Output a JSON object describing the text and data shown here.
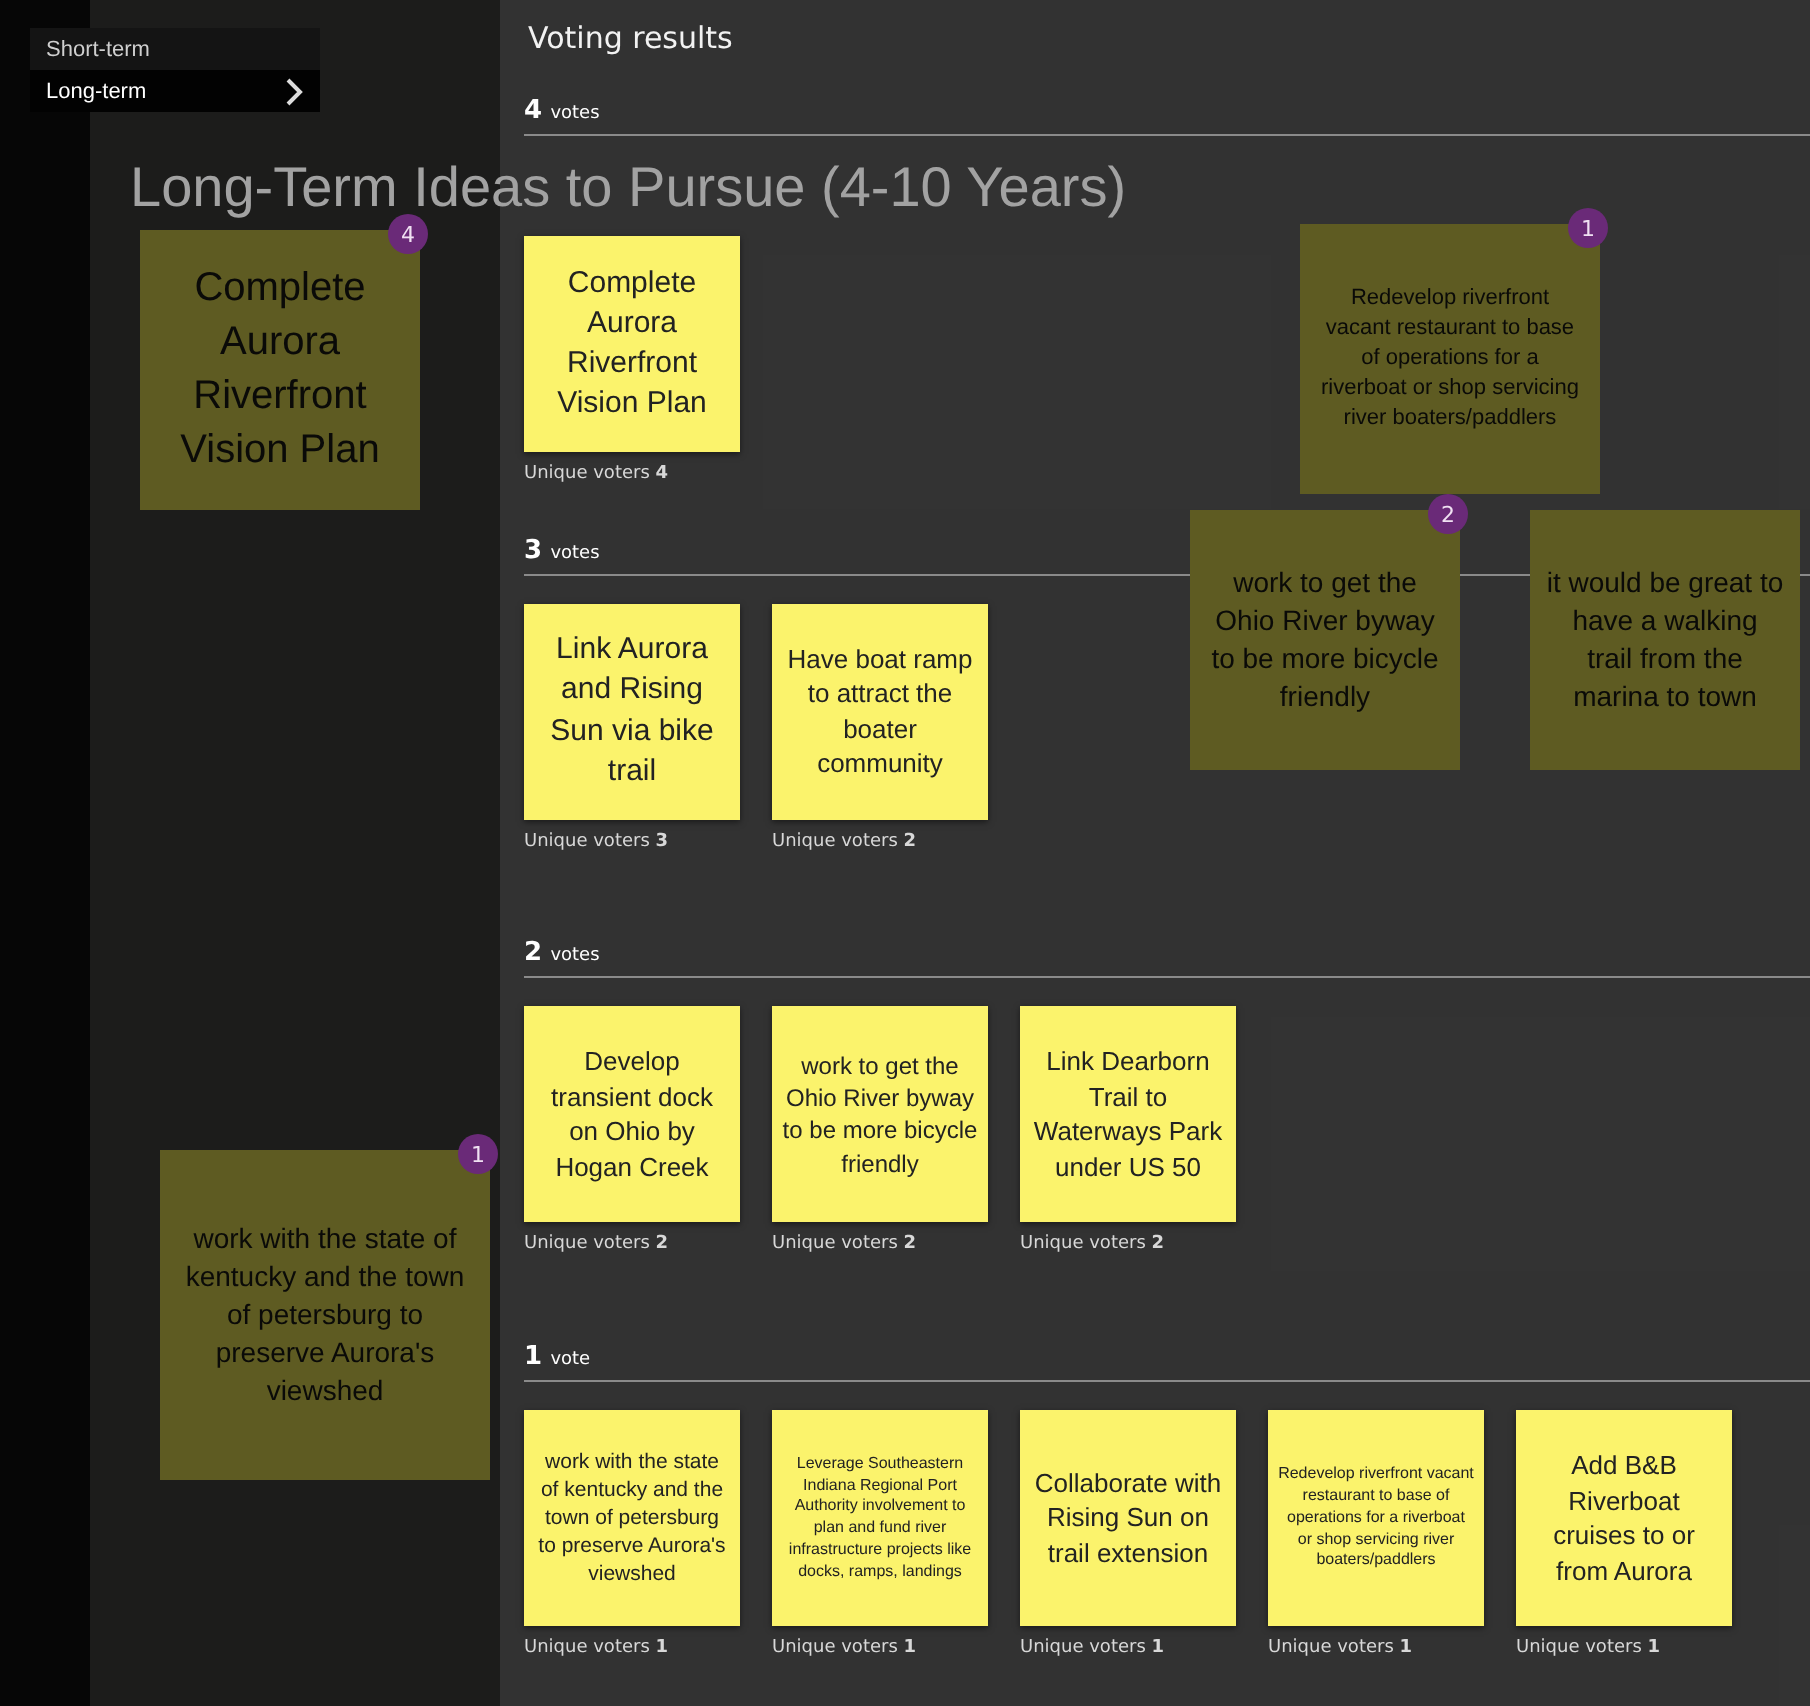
{
  "menu": {
    "items": [
      {
        "label": "Short-term",
        "selected": false
      },
      {
        "label": "Long-term",
        "selected": true
      }
    ]
  },
  "board": {
    "title": "Long-Term Ideas to Pursue (4-10 Years)",
    "notes": [
      {
        "text": "Complete Aurora Riverfront Vision Plan",
        "badge": "4"
      },
      {
        "text": "work with the state of kentucky and the town of petersburg to preserve Aurora's viewshed",
        "badge": "1"
      },
      {
        "text": "Redevelop riverfront vacant restaurant to base of operations for a riverboat or shop servicing river boaters/paddlers",
        "badge": "1"
      },
      {
        "text": "work to get the Ohio River byway to be more bicycle friendly",
        "badge": "2"
      },
      {
        "text": "it would be great to have a walking trail from the marina to town"
      }
    ]
  },
  "voting": {
    "title": "Voting results",
    "groups": [
      {
        "count": "4",
        "unit": "votes",
        "ideas": [
          {
            "text": "Complete Aurora Riverfront Vision Plan",
            "voters_label": "Unique voters",
            "voters": "4"
          }
        ]
      },
      {
        "count": "3",
        "unit": "votes",
        "ideas": [
          {
            "text": "Link Aurora and Rising Sun via bike trail",
            "voters_label": "Unique voters",
            "voters": "3"
          },
          {
            "text": "Have boat ramp to attract the boater community",
            "voters_label": "Unique voters",
            "voters": "2"
          }
        ]
      },
      {
        "count": "2",
        "unit": "votes",
        "ideas": [
          {
            "text": "Develop transient dock on Ohio by Hogan Creek",
            "voters_label": "Unique voters",
            "voters": "2"
          },
          {
            "text": "work to get the Ohio River byway to be more bicycle friendly",
            "voters_label": "Unique voters",
            "voters": "2"
          },
          {
            "text": "Link Dearborn Trail to Waterways Park under US 50",
            "voters_label": "Unique voters",
            "voters": "2"
          }
        ]
      },
      {
        "count": "1",
        "unit": "vote",
        "ideas": [
          {
            "text": "work with the state of kentucky and the town of petersburg to preserve Aurora's viewshed",
            "voters_label": "Unique voters",
            "voters": "1"
          },
          {
            "text": "Leverage Southeastern Indiana Regional Port Authority involvement to plan and fund river infrastructure projects like docks, ramps, landings",
            "voters_label": "Unique voters",
            "voters": "1"
          },
          {
            "text": "Collaborate with Rising Sun on trail extension",
            "voters_label": "Unique voters",
            "voters": "1"
          },
          {
            "text": "Redevelop riverfront vacant restaurant to base of operations for a riverboat or shop servicing river boaters/paddlers",
            "voters_label": "Unique voters",
            "voters": "1"
          },
          {
            "text": "Add B&B Riverboat cruises to or from Aurora",
            "voters_label": "Unique voters",
            "voters": "1"
          }
        ]
      }
    ]
  }
}
